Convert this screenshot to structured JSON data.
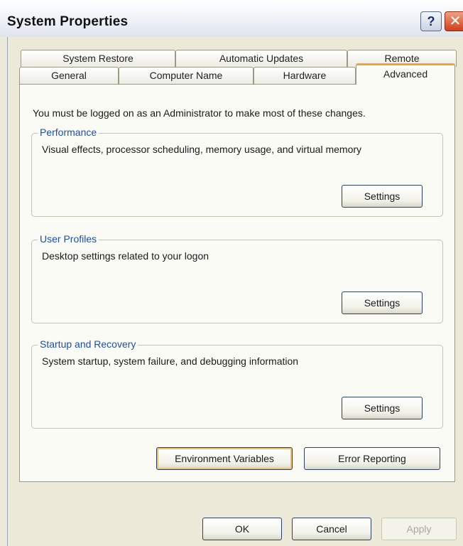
{
  "window": {
    "title": "System Properties",
    "help_glyph": "?",
    "close_glyph": "✕"
  },
  "tabs_row_back": [
    {
      "label": "System Restore"
    },
    {
      "label": "Automatic Updates"
    },
    {
      "label": "Remote"
    }
  ],
  "tabs_row_front": [
    {
      "label": "General"
    },
    {
      "label": "Computer Name"
    },
    {
      "label": "Hardware"
    },
    {
      "label": "Advanced",
      "active": true
    }
  ],
  "advanced": {
    "notice": "You must be logged on as an Administrator to make most of these changes.",
    "groups": [
      {
        "title": "Performance",
        "description": "Visual effects, processor scheduling, memory usage, and virtual memory",
        "button": "Settings"
      },
      {
        "title": "User Profiles",
        "description": "Desktop settings related to your logon",
        "button": "Settings"
      },
      {
        "title": "Startup and Recovery",
        "description": "System startup, system failure, and debugging information",
        "button": "Settings"
      }
    ],
    "environment_button": "Environment Variables",
    "error_reporting_button": "Error Reporting"
  },
  "footer": {
    "ok": "OK",
    "cancel": "Cancel",
    "apply": "Apply"
  },
  "colors": {
    "dialog_bg": "#ece9d8",
    "active_tab_accent": "#f0a330",
    "group_title": "#1e4fa8"
  }
}
